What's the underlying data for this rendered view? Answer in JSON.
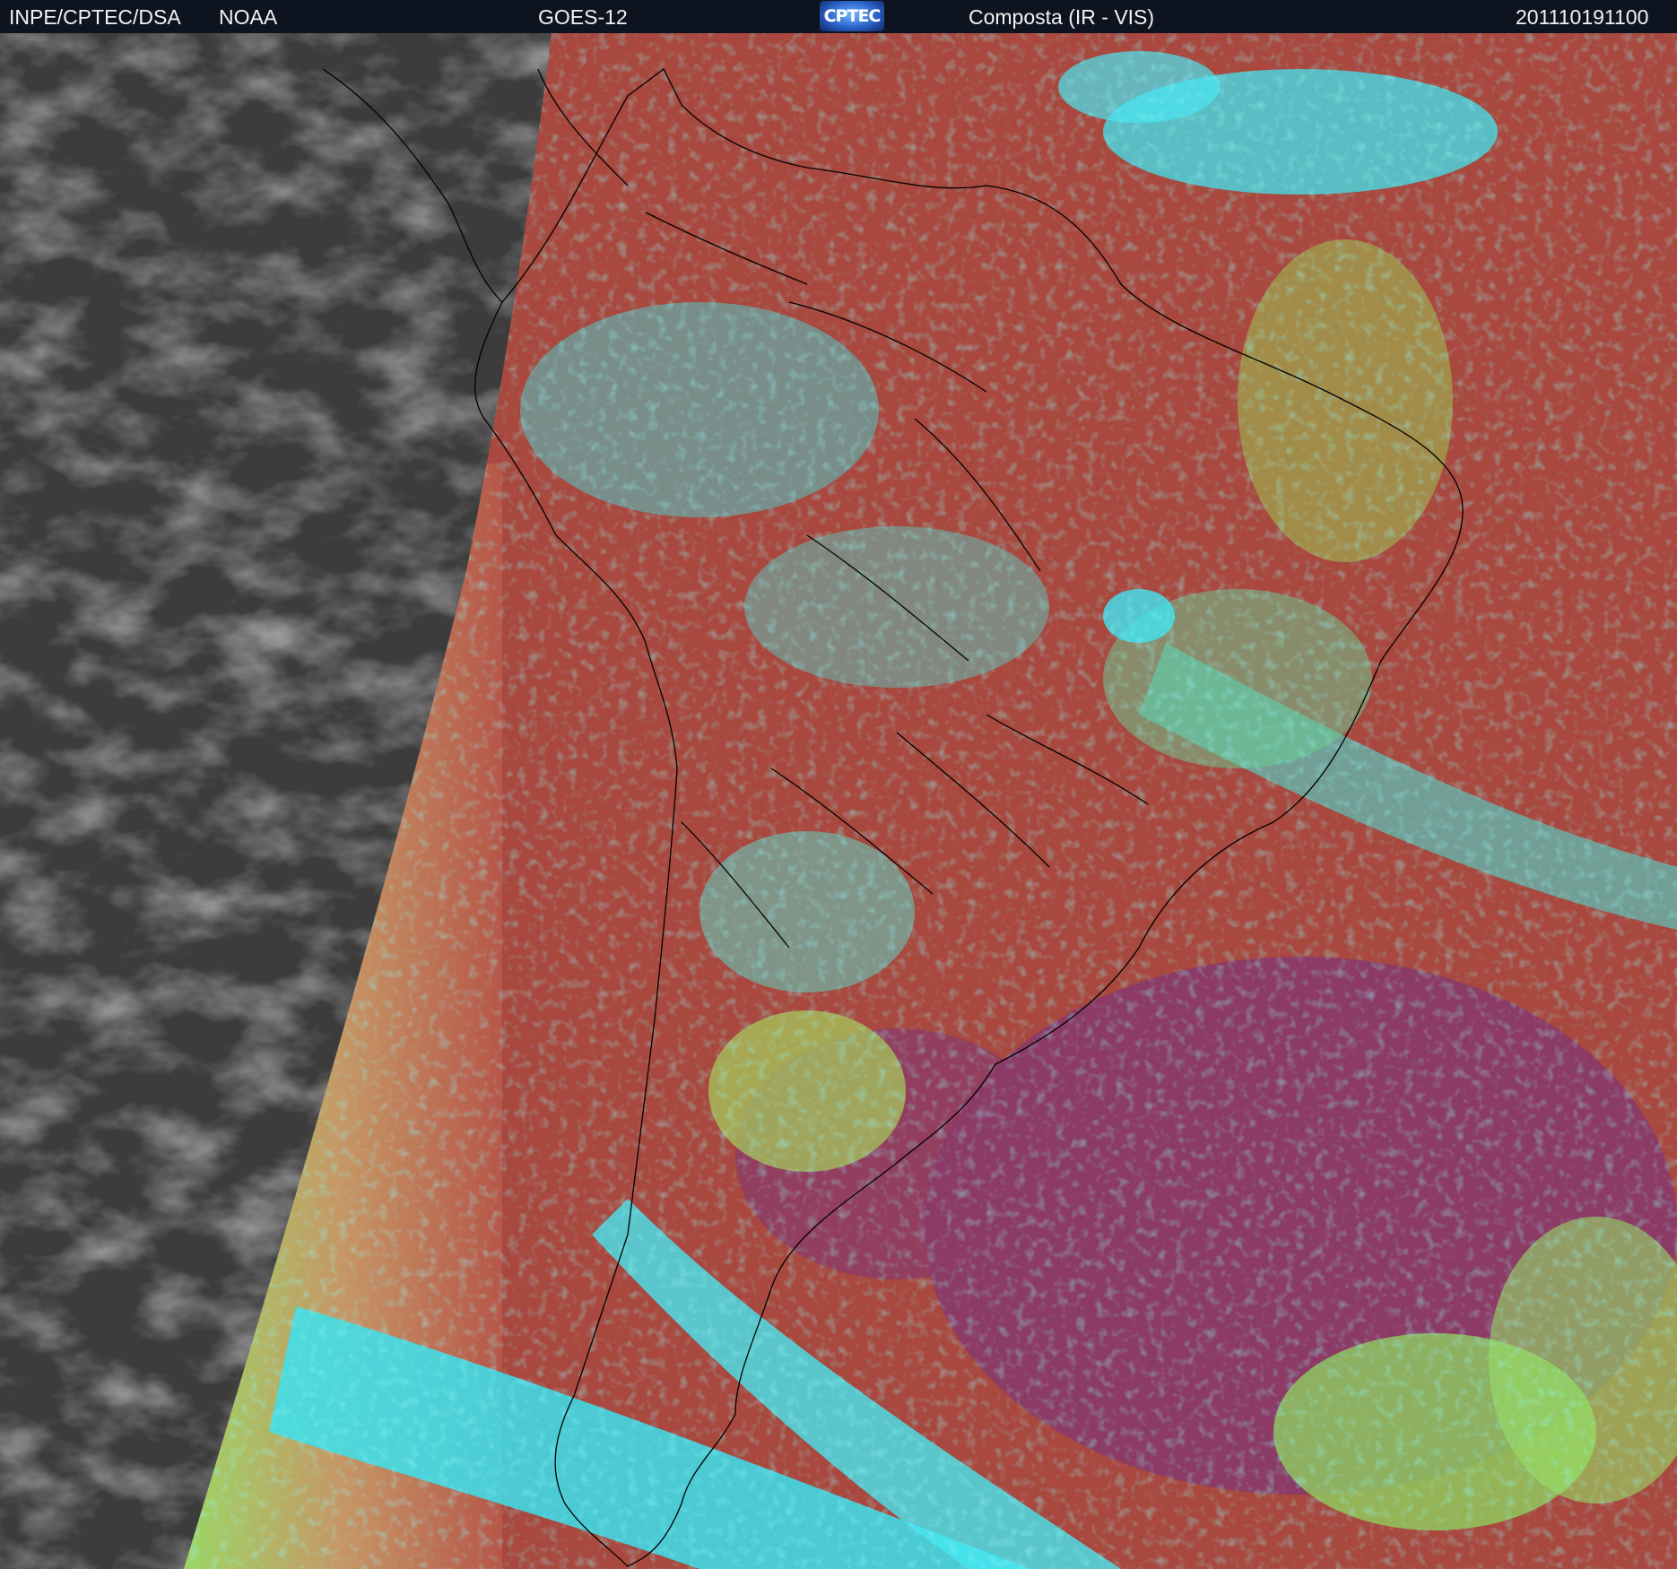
{
  "header": {
    "source": "INPE/CPTEC/DSA",
    "agency": "NOAA",
    "satellite": "GOES-12",
    "logo_text": "CPTEC",
    "product": "Composta (IR - VIS)",
    "timestamp": "201110191100"
  },
  "colors": {
    "header_bg": "#0d1420",
    "night_gray": "#3e3e3e",
    "land_red": "#a8443a",
    "cloud_cyan": "#33e6ee",
    "low_cloud_green": "#8fe060",
    "ocean_magenta": "#8a3a6e",
    "coastline": "#000000"
  }
}
